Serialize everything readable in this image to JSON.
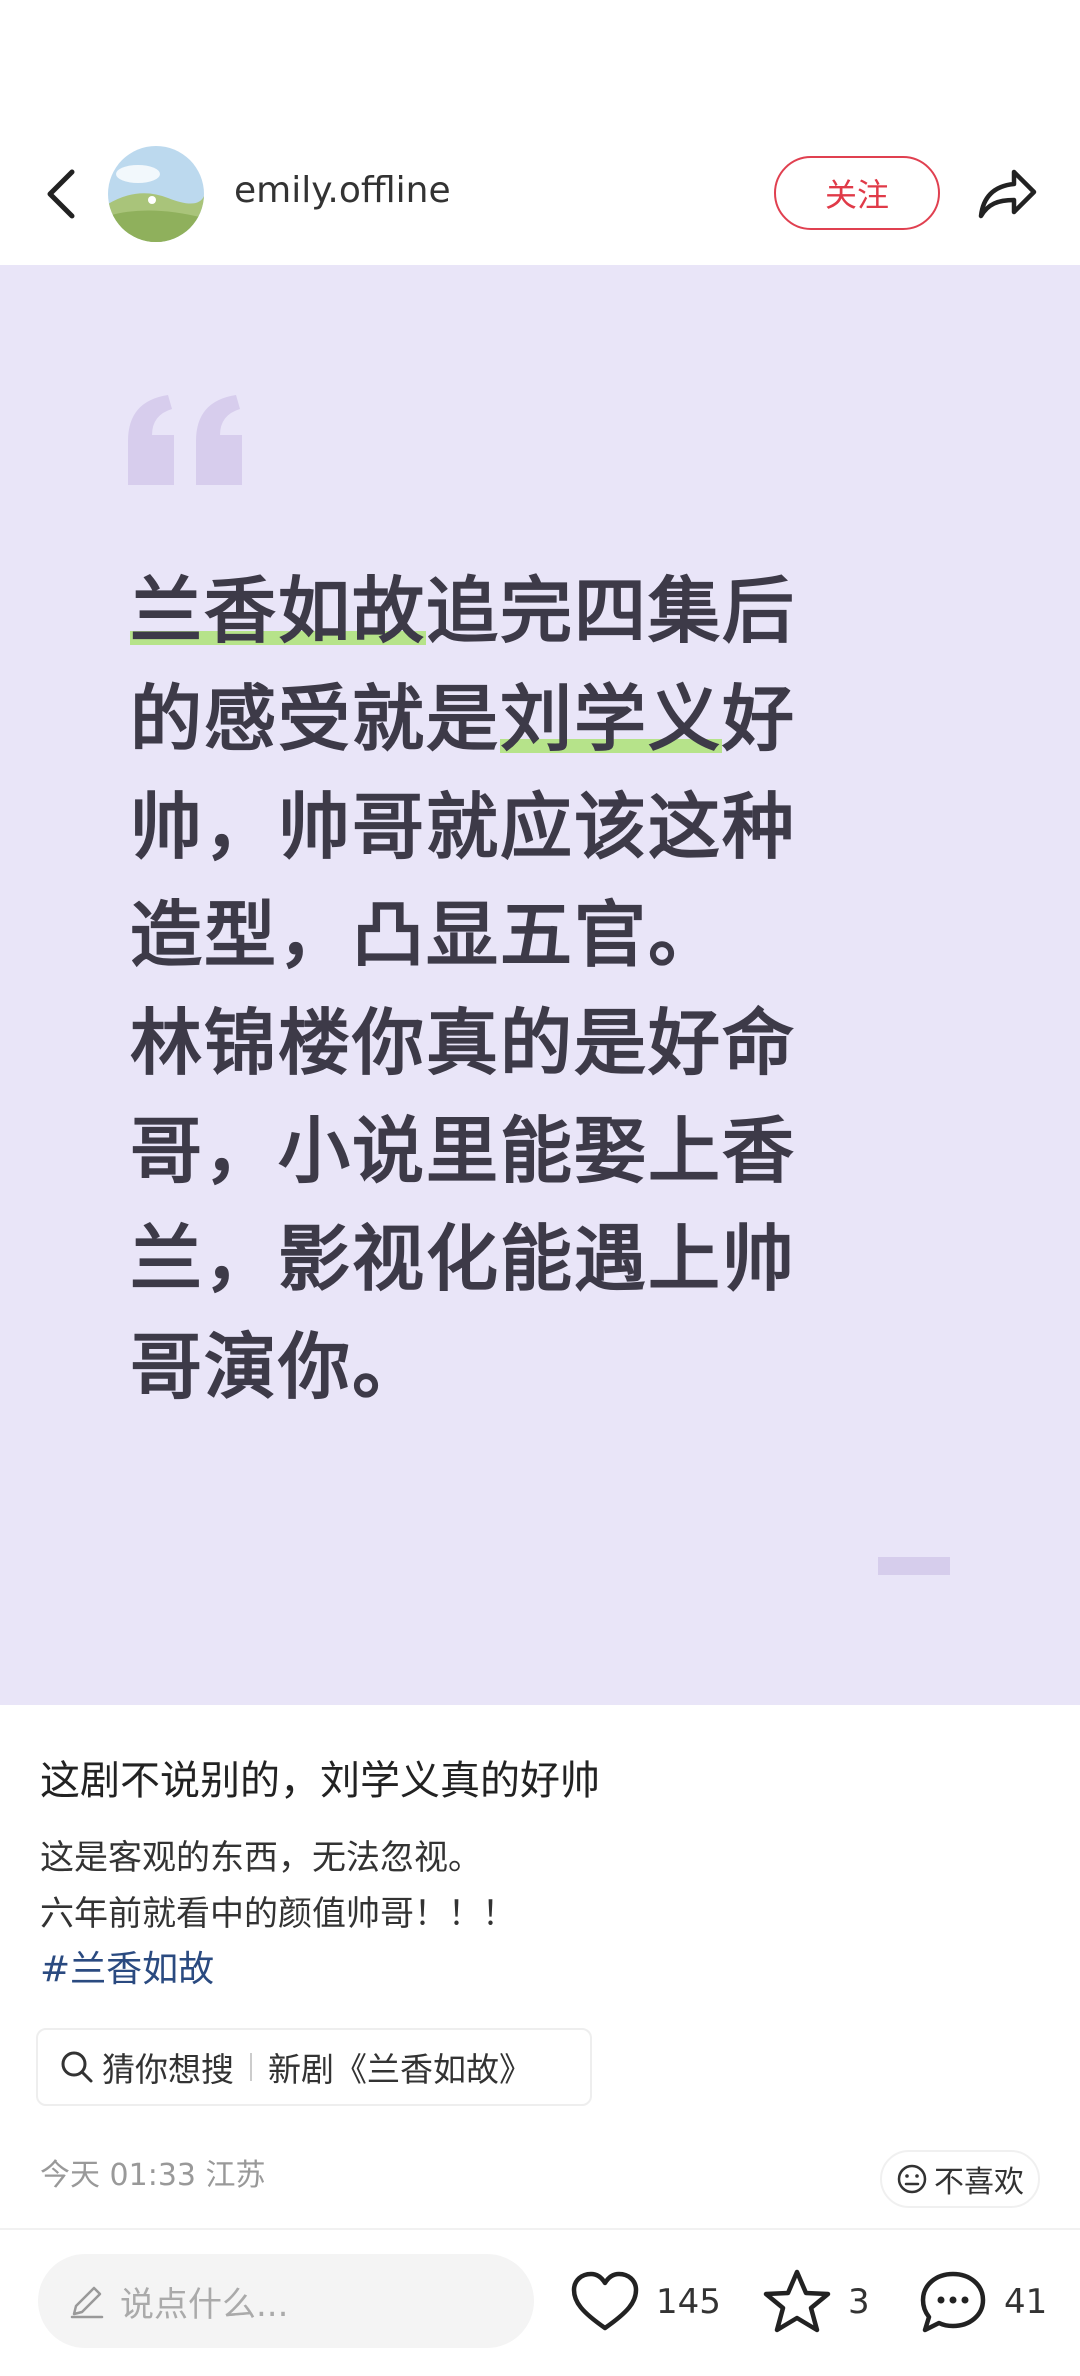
{
  "header": {
    "username": "emily.offline",
    "follow_label": "关注"
  },
  "quote": {
    "lines": [
      [
        "兰香如故",
        "追完四集后"
      ],
      [
        "的感受就是",
        "刘学义",
        "好"
      ],
      [
        "帅，帅哥就应该这种"
      ],
      [
        "造型，凸显五官。"
      ],
      [
        "林锦楼你真的是好命"
      ],
      [
        "哥，小说里能娶上香"
      ],
      [
        "兰，影视化能遇上帅"
      ],
      [
        "哥演你。"
      ]
    ],
    "highlight_color": "#b6e38a",
    "background_color": "#e9e5f8"
  },
  "post": {
    "title": "这剧不说别的，刘学义真的好帅",
    "body_line_1": "这是客观的东西，无法忽视。",
    "body_line_2": "六年前就看中的颜值帅哥！！！",
    "hashtag": "#兰香如故"
  },
  "search_suggest": {
    "prefix": "猜你想搜",
    "query": "新剧《兰香如故》"
  },
  "meta": {
    "time_location": "今天 01:33 江苏",
    "dislike_label": "不喜欢"
  },
  "bottom_bar": {
    "comment_placeholder": "说点什么...",
    "likes": "145",
    "favorites": "3",
    "comments": "41"
  },
  "colors": {
    "accent_red": "#e03a48",
    "hashtag_blue": "#2a4a80"
  }
}
